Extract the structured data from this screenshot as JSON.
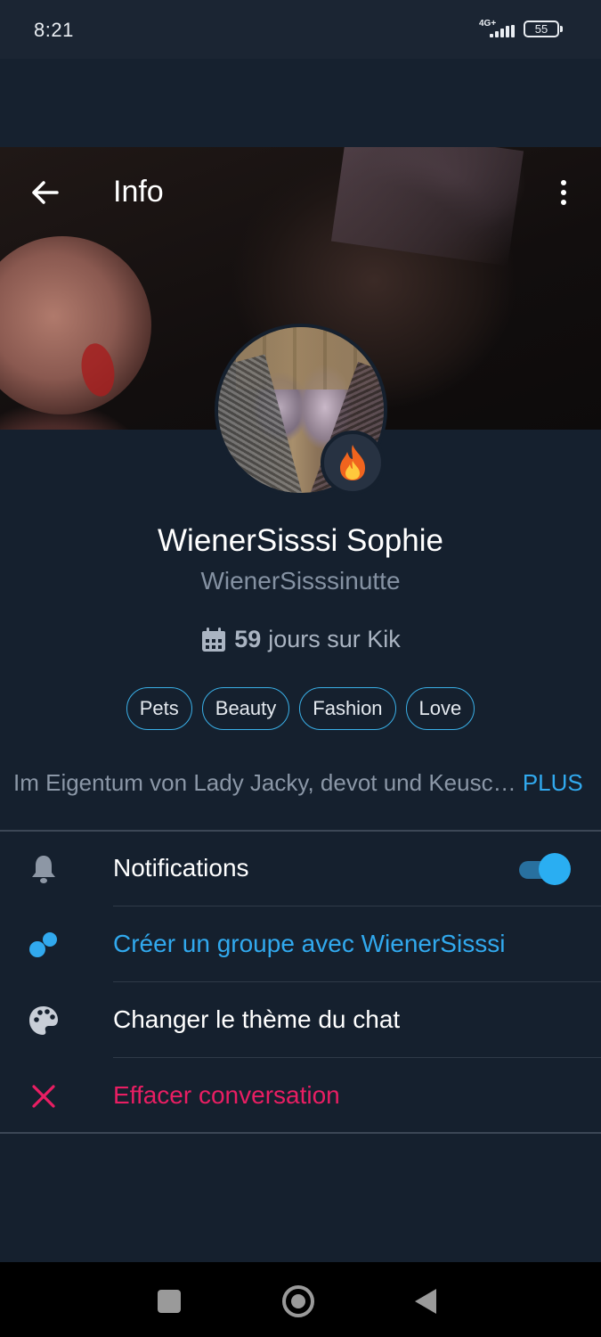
{
  "status_bar": {
    "time": "8:21",
    "network": "4G+",
    "battery": "55"
  },
  "toolbar": {
    "title": "Info",
    "back_icon": "arrow-left-icon",
    "more_icon": "more-vertical-icon"
  },
  "profile": {
    "display_name": "WienerSisssi Sophie",
    "username": "WienerSisssinutte",
    "days_count": "59",
    "days_label": "jours sur Kik",
    "badge_icon": "fire-icon",
    "tags": [
      "Pets",
      "Beauty",
      "Fashion",
      "Love"
    ],
    "bio": "Im Eigentum von Lady Jacky, devot und Keusc…",
    "bio_more": "PLUS"
  },
  "menu": {
    "notifications": {
      "label": "Notifications",
      "icon": "bell-icon",
      "enabled": true
    },
    "create_group": {
      "label": "Créer un groupe avec WienerSisssi",
      "icon": "group-dots-icon"
    },
    "change_theme": {
      "label": "Changer le thème du chat",
      "icon": "palette-icon"
    },
    "clear_conversation": {
      "label": "Effacer conversation",
      "icon": "close-x-icon"
    }
  },
  "colors": {
    "background": "#15202e",
    "accent": "#31a9ee",
    "danger": "#e91e63",
    "muted": "#8592a3"
  }
}
